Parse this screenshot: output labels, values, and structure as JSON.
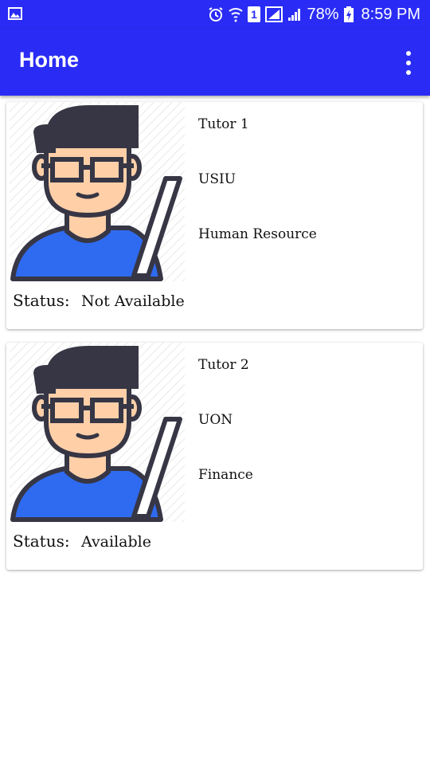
{
  "status_bar": {
    "battery_percent": "78%",
    "time": "8:59 PM",
    "sim_slot": "1",
    "icons": [
      "image-icon",
      "alarm-icon",
      "wifi-icon",
      "sim-icon",
      "signal-icon",
      "battery-icon"
    ]
  },
  "app_bar": {
    "title": "Home",
    "menu_icon": "overflow-menu-icon"
  },
  "tutors": [
    {
      "name": "Tutor 1",
      "school": "USIU",
      "department": "Human Resource",
      "status_label": "Status:",
      "status": "Not Available",
      "avatar_icon": "tutor-avatar-icon"
    },
    {
      "name": "Tutor 2",
      "school": "UON",
      "department": "Finance",
      "status_label": "Status:",
      "status": "Available",
      "avatar_icon": "tutor-avatar-icon"
    }
  ],
  "colors": {
    "primary": "#2a2cf5",
    "shirt": "#2f6bf0",
    "skin": "#ffcfa8",
    "outline": "#363645"
  }
}
